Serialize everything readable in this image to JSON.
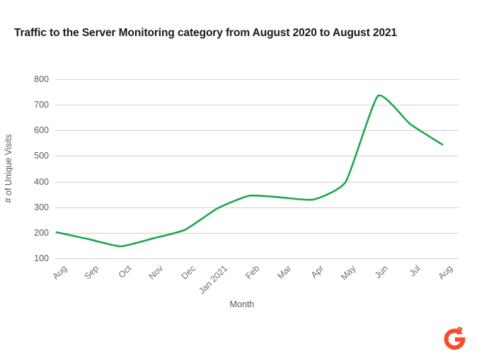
{
  "chart_data": {
    "type": "line",
    "title": "Traffic to the Server Monitoring category from August 2020 to August 2021",
    "xlabel": "Month",
    "ylabel": "# of Unique Visits",
    "categories": [
      "Aug",
      "Sep",
      "Oct",
      "Nov",
      "Dec",
      "Jan 2021",
      "Feb",
      "Mar",
      "Apr",
      "May",
      "Jun",
      "Jul",
      "Aug"
    ],
    "values": [
      202,
      175,
      147,
      178,
      212,
      295,
      345,
      338,
      330,
      400,
      735,
      625,
      545
    ],
    "series": [
      {
        "name": "# of Unique Visits",
        "values": [
          202,
          175,
          147,
          178,
          212,
          295,
          345,
          338,
          330,
          400,
          735,
          625,
          545
        ]
      }
    ],
    "yticks": [
      800,
      700,
      600,
      500,
      400,
      300,
      200,
      100
    ],
    "ylim": [
      100,
      800
    ],
    "grid": true,
    "legend": false,
    "line_color": "#1ba84c",
    "grid_color": "#d0d0d0",
    "smooth": true
  },
  "branding": {
    "logo_name": "G2",
    "logo_letter": "G",
    "logo_superscript": "2",
    "logo_color": "#ff492c"
  }
}
